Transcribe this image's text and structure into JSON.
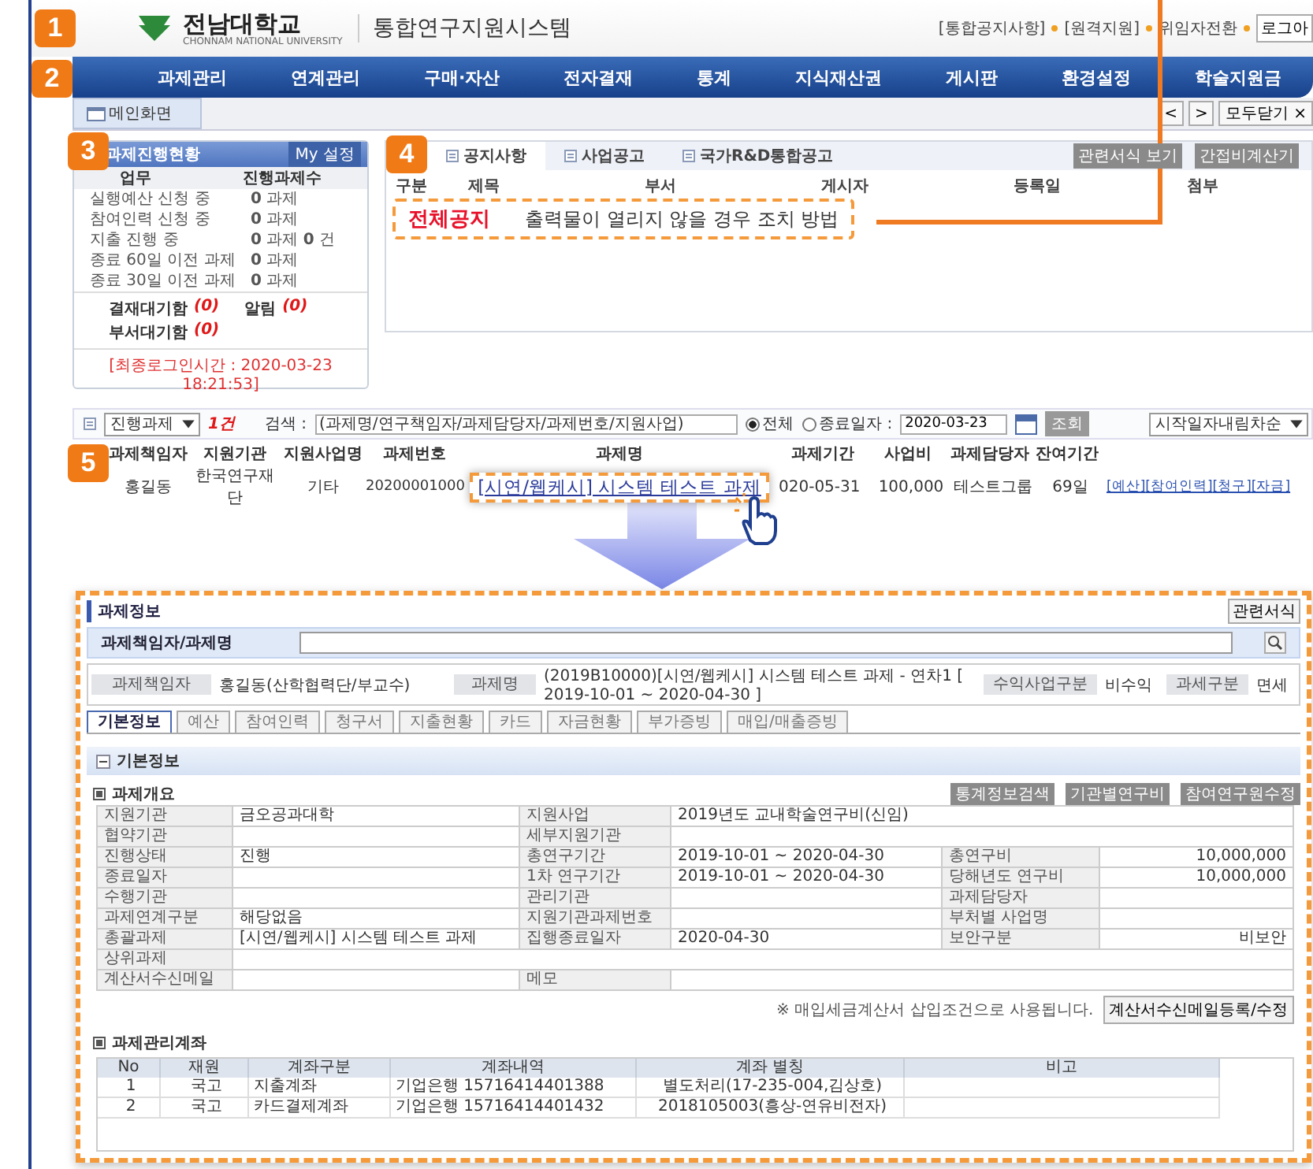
{
  "header": {
    "logo": "전남대학교",
    "logo_sub": "CHONNAM NATIONAL UNIVERSITY",
    "system_name": "통합연구지원시스템",
    "links": [
      "[통합공지사항]",
      "[원격지원]",
      "위임자전환"
    ],
    "logout": "로그아"
  },
  "callouts": [
    "1",
    "2",
    "3",
    "4",
    "5"
  ],
  "nav": [
    {
      "label": "과제관리"
    },
    {
      "label": "연계관리"
    },
    {
      "label": "구매·자산"
    },
    {
      "label": "전자결재"
    },
    {
      "label": "통계"
    },
    {
      "label": "지식재산권"
    },
    {
      "label": "게시판"
    },
    {
      "label": "환경설정"
    },
    {
      "label": "학술지원금"
    }
  ],
  "page_tabs": [
    {
      "label": "메인화면",
      "selected": true
    }
  ],
  "tab_controls": {
    "prev": "<",
    "next": ">",
    "close_all": "모두닫기 ×"
  },
  "status_panel": {
    "title": "과제진행현황",
    "button": "My 설정",
    "columns": [
      "업무",
      "진행과제수"
    ],
    "rows": [
      {
        "task": "실행예산 신청 중",
        "count": "**0** 과제"
      },
      {
        "task": "참여인력 신청 중",
        "count": "**0** 과제"
      },
      {
        "task": "지출 진행 중",
        "count": "**0** 과제 **0** 건"
      },
      {
        "task": "종료 60일 이전 과제",
        "count": "**0** 과제"
      },
      {
        "task": "종료 30일 이전 과제",
        "count": "**0** 과제"
      }
    ],
    "counters": [
      {
        "label": "결재대기함",
        "value": "(0)"
      },
      {
        "label": "알림",
        "value": "(0)"
      },
      {
        "label": "부서대기함",
        "value": "(0)"
      }
    ],
    "last_login": "[최종로그인시간 : 2020-03-23 18:21:53]"
  },
  "notice_panel": {
    "tabs": [
      {
        "label": "공지사항",
        "selected": true
      },
      {
        "label": "사업공고",
        "selected": false
      },
      {
        "label": "국가R&D통합공고",
        "selected": false
      }
    ],
    "buttons": [
      "관련서식 보기",
      "간접비계산기"
    ],
    "columns": [
      "구분",
      "제목",
      "부서",
      "게시자",
      "등록일",
      "첨부"
    ],
    "rows": [
      {
        "category": "전체공지",
        "title": "출력물이 열리지 않을 경우 조치 방법",
        "highlighted": true
      }
    ]
  },
  "project_search": {
    "status_select": "진행과제",
    "count": "1건",
    "search_label": "검색 :",
    "search_placeholder": "(과제명/연구책임자/과제담당자/과제번호/지원사업)",
    "radios": [
      {
        "label": "전체",
        "selected": true
      },
      {
        "label": "종료일자 :",
        "selected": false
      }
    ],
    "date": "2020-03-23",
    "search_button": "조회",
    "sort_select": "시작일자내림차순"
  },
  "project_table": {
    "columns": [
      "과제책임자",
      "지원기관",
      "지원사업명",
      "과제번호",
      "과제명",
      "과제기간",
      "사업비",
      "과제담당자",
      "잔여기간"
    ],
    "rows": [
      {
        "leader": "홍길동",
        "agency": "한국연구재단",
        "program": "기타",
        "number": "20200001000",
        "title": "[시연/웹케시] 시스템 테스트 과제",
        "period": "020-05-31",
        "budget": "100,000",
        "manager": "테스트그룹",
        "remaining": "69일",
        "links": [
          "[예산]",
          "[참여인력]",
          "[청구]",
          "[자금]"
        ],
        "highlighted": true
      }
    ]
  },
  "project_detail": {
    "title": "과제정보",
    "form_button": "관련서식",
    "search_label": "과제책임자/과제명",
    "summary": [
      {
        "label": "과제책임자",
        "value": "홍길동(산학협력단/부교수)"
      },
      {
        "label": "과제명",
        "value": "(2019B10000)[시연/웹케시] 시스템 테스트 과제 - 연차1 [ 2019-10-01 ~ 2020-04-30 ]"
      },
      {
        "label": "수익사업구분",
        "value": "비수익"
      },
      {
        "label": "과세구분",
        "value": "면세"
      }
    ],
    "tabs": [
      {
        "label": "기본정보",
        "selected": true
      },
      {
        "label": "예산",
        "selected": false
      },
      {
        "label": "참여인력",
        "selected": false
      },
      {
        "label": "청구서",
        "selected": false
      },
      {
        "label": "지출현황",
        "selected": false
      },
      {
        "label": "카드",
        "selected": false
      },
      {
        "label": "자금현황",
        "selected": false
      },
      {
        "label": "부가증빙",
        "selected": false
      },
      {
        "label": "매입/매출증빙",
        "selected": false
      }
    ],
    "section": "기본정보",
    "overview_title": "과제개요",
    "overview_buttons": [
      "통계정보검색",
      "기관별연구비",
      "참여연구원수정"
    ],
    "overview_rows": [
      [
        {
          "label": "지원기관",
          "value": "금오공과대학"
        },
        {
          "label": "지원사업",
          "value": "2019년도 교내학술연구비(신임)"
        }
      ],
      [
        {
          "label": "협약기관"
        },
        {
          "label": "세부지원기관"
        }
      ],
      [
        {
          "label": "진행상태",
          "value": "진행"
        },
        {
          "label": "총연구기간",
          "value": "2019-10-01 ~ 2020-04-30"
        },
        {
          "label": "총연구비",
          "value": "10,000,000"
        }
      ],
      [
        {
          "label": "종료일자"
        },
        {
          "label": "1차 연구기간",
          "value": "2019-10-01 ~ 2020-04-30"
        },
        {
          "label": "당해년도 연구비",
          "value": "10,000,000"
        }
      ],
      [
        {
          "label": "수행기관"
        },
        {
          "label": "관리기관"
        },
        {
          "label": "과제담당자"
        }
      ],
      [
        {
          "label": "과제연계구분",
          "value": "해당없음"
        },
        {
          "label": "지원기관과제번호"
        },
        {
          "label": "부처별 사업명"
        }
      ],
      [
        {
          "label": "총괄과제",
          "value": "[시연/웹케시] 시스템 테스트 과제"
        },
        {
          "label": "집행종료일자",
          "value": "2020-04-30"
        },
        {
          "label": "보안구분",
          "value": "비보안"
        }
      ],
      [
        {
          "label": "상위과제"
        }
      ],
      [
        {
          "label": "계산서수신메일"
        },
        {
          "label": "메모"
        }
      ]
    ],
    "note": "※ 매입세금계산서 삽입조건으로 사용됩니다.",
    "mail_button": "계산서수신메일등록/수정",
    "accounts_title": "과제관리계좌",
    "account_columns": [
      "No",
      "재원",
      "계좌구분",
      "계좌내역",
      "계좌 별칭",
      "비고"
    ],
    "accounts": [
      {
        "no": "1",
        "source": "국고",
        "type": "지출계좌",
        "detail": "기업은행 15716414401388",
        "alias": "별도처리(17-235-004,김상호)"
      },
      {
        "no": "2",
        "source": "국고",
        "type": "카드결제계좌",
        "detail": "기업은행 15716414401432",
        "alias": "2018105003(흥상-연유비전자)"
      }
    ]
  }
}
